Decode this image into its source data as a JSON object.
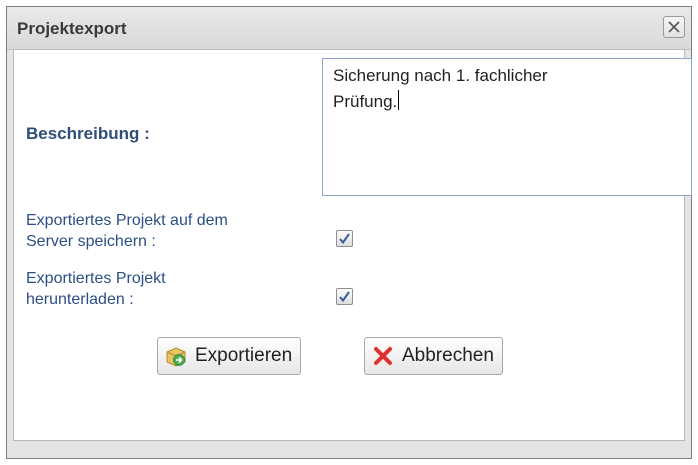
{
  "dialog": {
    "title": "Projektexport",
    "close_icon": "close-icon"
  },
  "form": {
    "description_label": "Beschreibung :",
    "description_value": "Sicherung nach 1. fachlicher\nPrüfung.",
    "option_server": {
      "label": "Exportiertes Projekt auf dem\nServer speichern :",
      "checked": true
    },
    "option_download": {
      "label": "Exportiertes Projekt\nherunterladen :",
      "checked": true
    }
  },
  "buttons": {
    "export_label": "Exportieren",
    "export_icon": "export-box-icon",
    "cancel_label": "Abbrechen",
    "cancel_icon": "red-x-icon"
  },
  "colors": {
    "label_blue": "#2b4f86",
    "cancel_red": "#e03030"
  }
}
